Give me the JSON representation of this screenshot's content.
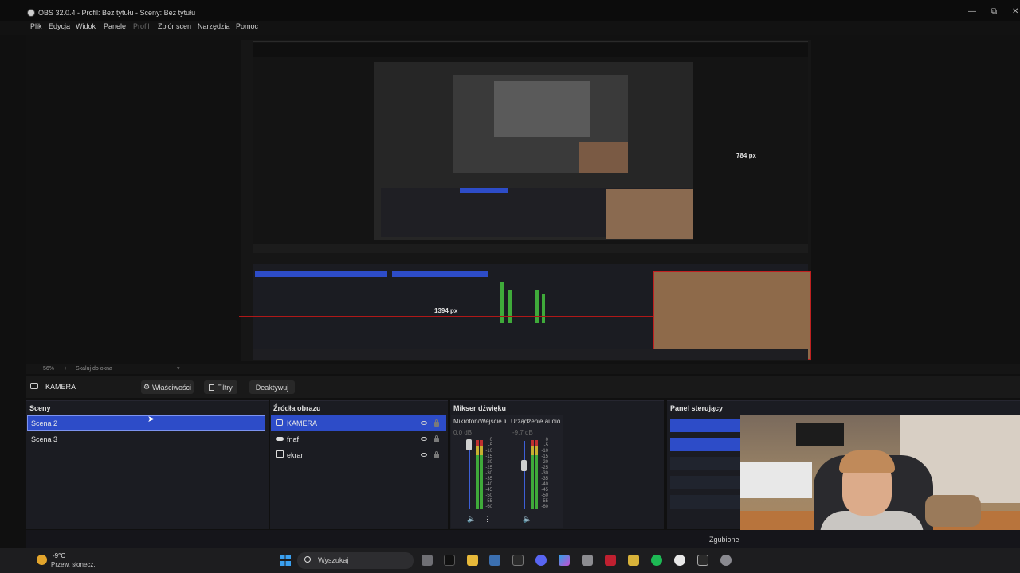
{
  "window": {
    "title": "OBS 32.0.4 - Profil: Bez tytułu - Sceny: Bez tytułu",
    "minimize": "—",
    "maximize": "⧉",
    "close": "✕"
  },
  "menu": [
    "Plik",
    "Edycja",
    "Widok",
    "Panele",
    "Profil",
    "Zbiór scen",
    "Narzędzia",
    "Pomoc"
  ],
  "preview": {
    "measure_height": "784 px",
    "measure_width": "1394 px"
  },
  "zoom": {
    "minus": "−",
    "value": "56%",
    "plus": "+",
    "fit_label": "Skaluj do okna",
    "fit_chevron": "▾"
  },
  "source_toolbar": {
    "selected_source": "KAMERA",
    "properties": "Właściwości",
    "filters": "Filtry",
    "deactivate": "Deaktywuj"
  },
  "scenes": {
    "title": "Sceny",
    "items": [
      "Scena 2",
      "Scena 3"
    ]
  },
  "sources": {
    "title": "Źródła obrazu",
    "items": [
      "KAMERA",
      "fnaf",
      "ekran"
    ]
  },
  "mixer": {
    "title": "Mikser dźwięku",
    "channels": [
      {
        "name": "Mikrofon/Wejście li",
        "db": "0.0 dB",
        "level": 0.75
      },
      {
        "name": "Urządzenie audio",
        "db": "-9.7 dB",
        "level": 0.55
      }
    ],
    "scale": [
      "0",
      "-5",
      "-10",
      "-15",
      "-20",
      "-25",
      "-30",
      "-35",
      "-40",
      "-45",
      "-50",
      "-55",
      "-60"
    ]
  },
  "control_panel": {
    "title": "Panel sterujący"
  },
  "status": {
    "text": "Zgubione"
  },
  "taskbar": {
    "temperature": "-9°C",
    "weather": "Przew. słonecz.",
    "search_placeholder": "Wyszukaj"
  },
  "colors": {
    "accent": "#2d4cc8",
    "background": "#101010",
    "dock": "#1b1c22",
    "red_guide": "#b01818"
  }
}
